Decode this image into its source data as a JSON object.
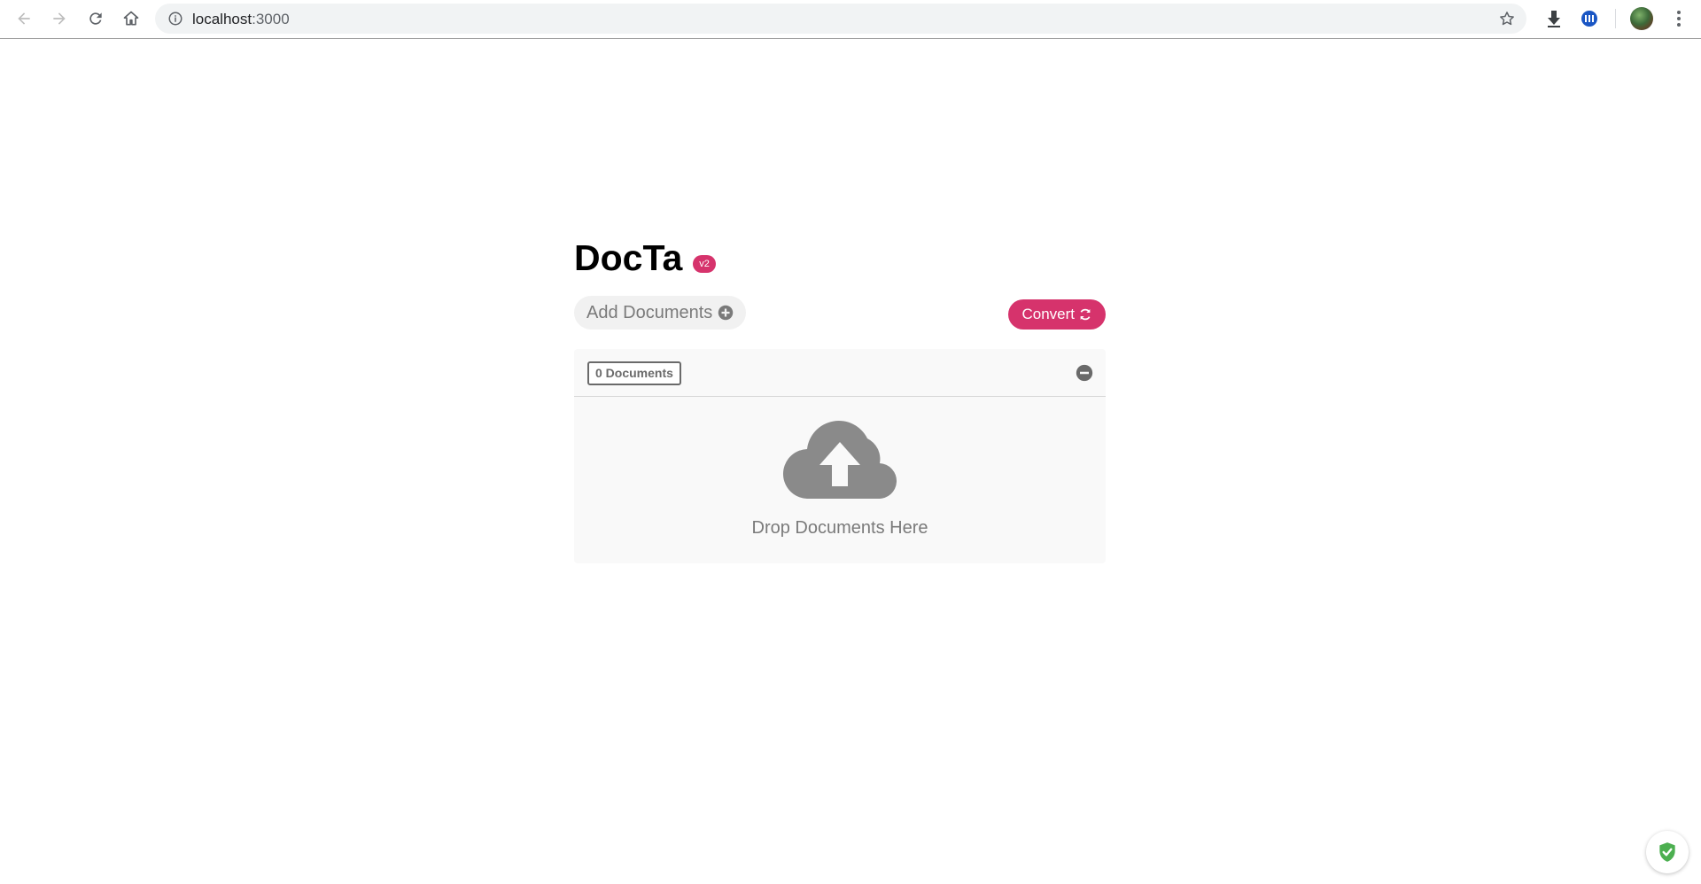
{
  "browser": {
    "url_host": "localhost",
    "url_port": ":3000",
    "icons": [
      "back-icon",
      "forward-icon",
      "reload-icon",
      "home-icon",
      "info-icon",
      "star-icon",
      "download-icon",
      "extension-icon",
      "avatar",
      "menu-icon"
    ]
  },
  "app": {
    "title": "DocTa",
    "version": "v2",
    "add_documents_label": "Add Documents",
    "convert_label": "Convert",
    "document_count_label": "0 Documents",
    "drop_label": "Drop Documents Here"
  },
  "colors": {
    "accent": "#d6336c",
    "muted_text": "#7a7a7a",
    "panel_bg": "#f9f9f9",
    "cloud": "#8a8a8a",
    "shield": "#4caf50"
  }
}
